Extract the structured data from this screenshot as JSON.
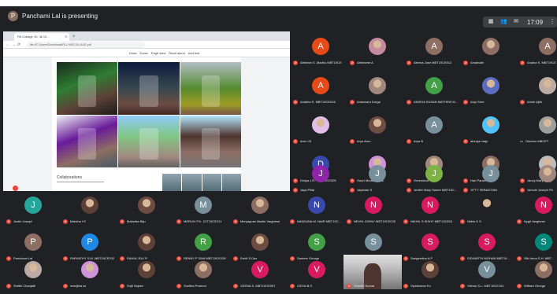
{
  "header": {
    "presenter_initial": "P",
    "presenting_text": "Panchami Lal is presenting",
    "clock": "17:09",
    "presenter_avatar_color": "#8d6e63"
  },
  "share": {
    "tab_title": "Fill Collage 10. 4k 10...",
    "url": "file:///C:/Users/Downloads/FILL%20COLLAGE.pdf",
    "pdf_tools": [
      "Draw",
      "Erase",
      "Page view",
      "Read aloud",
      "Add text"
    ],
    "section_title": "Collaborations"
  },
  "tiles_right": [
    {
      "initial": "A",
      "name": "Abhiram S. Madhu MBT19CE",
      "color": "#e64a19"
    },
    {
      "initial": "",
      "name": "Abhirame A",
      "color": "#c48b9f",
      "photo": true
    },
    {
      "initial": "A",
      "name": "Aleena Jose MBT19CE012",
      "color": "#8d6e63"
    },
    {
      "initial": "",
      "name": "Amalnath",
      "color": "#8d6e63",
      "photo": true
    },
    {
      "initial": "A",
      "name": "Anaina S. MBT19CE",
      "color": "#8d6e63"
    },
    {
      "initial": "A",
      "name": "Anakha S. MBT19CE016",
      "color": "#e64a19"
    },
    {
      "initial": "",
      "name": "Anaswara Durga",
      "color": "#a1887f",
      "photo": true
    },
    {
      "initial": "A",
      "name": "ANISHA SUSAN MATHEW M...",
      "color": "#43a047"
    },
    {
      "initial": "",
      "name": "Anju Sree",
      "color": "#5c6bc0",
      "photo": true
    },
    {
      "initial": "",
      "name": "Annie Ajith",
      "color": "#bcaaa4",
      "photo": true
    },
    {
      "initial": "",
      "name": "Arun JS",
      "color": "#e1bee7",
      "photo": true
    },
    {
      "initial": "",
      "name": "Arya Arun",
      "color": "#6d4c41",
      "photo": true
    },
    {
      "initial": "A",
      "name": "Arya B",
      "color": "#78909c"
    },
    {
      "initial": "",
      "name": "athulya viaju",
      "color": "#4fc3f7",
      "photo": true
    },
    {
      "initial": "",
      "name": "Director MBCET",
      "color": "#9e9e9e",
      "photo": true,
      "dots": true
    },
    {
      "initial": "D",
      "name": "Diniya J.R. MBT19CE005",
      "color": "#3949ab"
    },
    {
      "initial": "",
      "name": "Gauri Muralidharan",
      "color": "#ce93d8",
      "photo": true
    },
    {
      "initial": "",
      "name": "Greeshma",
      "color": "#a1887f",
      "photo": true
    },
    {
      "initial": "",
      "name": "Hari Paramkumar",
      "color": "#8d6e63",
      "photo": true
    },
    {
      "initial": "",
      "name": "Jancy Mary Elsey",
      "color": "#bdbdbd",
      "photo": true
    },
    {
      "initial": "J",
      "name": "Jaya Pillai",
      "color": "#8e24aa"
    },
    {
      "initial": "J",
      "name": "Jayaram S",
      "color": "#78909c"
    },
    {
      "initial": "J",
      "name": "Jenifer Mary Samer MBT19C...",
      "color": "#7cb342"
    },
    {
      "initial": "J",
      "name": "JITTY SEBASTIAN",
      "color": "#78909c"
    },
    {
      "initial": "",
      "name": "Jomole Joseph Ph",
      "color": "#a1887f",
      "photo": true
    }
  ],
  "tiles_bottom": [
    {
      "initial": "J",
      "name": "Justin Joseph",
      "color": "#26a69a"
    },
    {
      "initial": "",
      "name": "Malvina VC",
      "color": "#5d4037",
      "photo": true
    },
    {
      "initial": "",
      "name": "Malavika Biju",
      "color": "#6d4c41",
      "photo": true
    },
    {
      "initial": "M",
      "name": "MERLIN P.K. JOT19CE011",
      "color": "#78909c"
    },
    {
      "initial": "",
      "name": "Meryappan Martin Varghese",
      "color": "#8d6e63",
      "photo": true
    },
    {
      "initial": "N",
      "name": "NANDANA M. NAIR MBT19C...",
      "color": "#3949ab"
    },
    {
      "initial": "N",
      "name": "NEVIN JOHNY MBT19CE026",
      "color": "#d81b60"
    },
    {
      "initial": "N",
      "name": "NIKHIL S KISHY MBT19CE01",
      "color": "#d81b60"
    },
    {
      "initial": "",
      "name": "Nithin K S",
      "color": "#212121",
      "photo": true
    },
    {
      "initial": "N",
      "name": "Nygil Varghese",
      "color": "#d81b60"
    },
    {
      "initial": "P",
      "name": "Panchami Lal",
      "color": "#8d6e63"
    },
    {
      "initial": "P",
      "name": "PARVATHY S.M. MBT19CE032",
      "color": "#1e88e5"
    },
    {
      "initial": "",
      "name": "RAHUL RAJ R",
      "color": "#5d4037",
      "photo": true
    },
    {
      "initial": "R",
      "name": "RENNY P SAM MBT19CE039",
      "color": "#43a047"
    },
    {
      "initial": "",
      "name": "Rohit S Das",
      "color": "#6d4c41",
      "photo": true
    },
    {
      "initial": "S",
      "name": "Sameer George",
      "color": "#43a047"
    },
    {
      "initial": "S",
      "name": "Sandra S.L. MBT19CE039",
      "color": "#78909c"
    },
    {
      "initial": "S",
      "name": "Sangeertha A.P",
      "color": "#d81b60"
    },
    {
      "initial": "S",
      "name": "SIDHARTH MOHAN MBT19...",
      "color": "#d81b60"
    },
    {
      "initial": "S",
      "name": "Silk Anna S.H. MBT...",
      "color": "#00897b"
    },
    {
      "initial": "",
      "name": "Smithi Chanjath",
      "color": "#bcaaa4",
      "photo": true
    },
    {
      "initial": "",
      "name": "sreejitha ss",
      "color": "#ce93d8",
      "photo": true
    },
    {
      "initial": "",
      "name": "Srijit Sajeev",
      "color": "#5d4037",
      "photo": true
    },
    {
      "initial": "",
      "name": "Sunitha Pramod",
      "color": "#8d6e63",
      "photo": true
    },
    {
      "initial": "V",
      "name": "VEENA S. MBT19CE057",
      "color": "#d81b60"
    },
    {
      "initial": "V",
      "name": "VIDYA B.S",
      "color": "#d81b60"
    },
    {
      "initial": "",
      "name": "Vineeth Kumar",
      "color": "#757575",
      "video": true
    },
    {
      "initial": "",
      "name": "Vipinkumar Kc",
      "color": "#5d4037",
      "photo": true
    },
    {
      "initial": "V",
      "name": "Vishnu S.L. MBT19CE101",
      "color": "#78909c"
    },
    {
      "initial": "",
      "name": "William George",
      "color": "#8d6e63",
      "photo": true
    }
  ]
}
